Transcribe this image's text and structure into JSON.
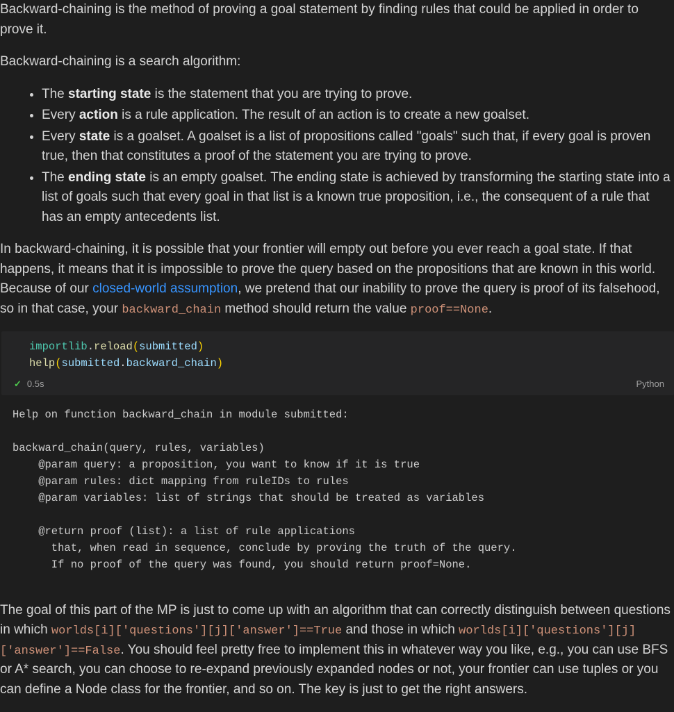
{
  "intro": {
    "para1": "Backward-chaining is the method of proving a goal statement by finding rules that could be applied in order to prove it.",
    "para2": "Backward-chaining is a search algorithm:",
    "bullets": [
      {
        "lead": "The ",
        "strong": "starting state",
        "rest": " is the statement that you are trying to prove."
      },
      {
        "lead": "Every ",
        "strong": "action",
        "rest": " is a rule application. The result of an action is to create a new goalset."
      },
      {
        "lead": "Every ",
        "strong": "state",
        "rest": " is a goalset. A goalset is a list of propositions called \"goals\" such that, if every goal is proven true, then that constitutes a proof of the statement you are trying to prove."
      },
      {
        "lead": "The ",
        "strong": "ending state",
        "rest": " is an empty goalset. The ending state is achieved by transforming the starting state into a list of goals such that every goal in that list is a known true proposition, i.e., the consequent of a rule that has an empty antecedents list."
      }
    ],
    "para3a": "In backward-chaining, it is possible that your frontier will empty out before you ever reach a goal state. If that happens, it means that it is impossible to prove the query based on the propositions that are known in this world. Because of our ",
    "link_text": "closed-world assumption",
    "para3b": ", we pretend that our inability to prove the query is proof of its falsehood, so in that case, your ",
    "code1": "backward_chain",
    "para3c": " method should return the value ",
    "code2": "proof==None",
    "para3d": "."
  },
  "cell": {
    "code_tokens": {
      "l1": {
        "a": "importlib",
        "b": ".",
        "c": "reload",
        "d": "(",
        "e": "submitted",
        "f": ")"
      },
      "l2": {
        "a": "help",
        "b": "(",
        "c": "submitted",
        "d": ".",
        "e": "backward_chain",
        "f": ")"
      }
    },
    "status_time": "0.5s",
    "kernel": "Python"
  },
  "output_text": "Help on function backward_chain in module submitted:\n\nbackward_chain(query, rules, variables)\n    @param query: a proposition, you want to know if it is true\n    @param rules: dict mapping from ruleIDs to rules\n    @param variables: list of strings that should be treated as variables\n    \n    @return proof (list): a list of rule applications\n      that, when read in sequence, conclude by proving the truth of the query.\n      If no proof of the query was found, you should return proof=None.",
  "tail": {
    "a": "The goal of this part of the MP is just to come up with an algorithm that can correctly distinguish between questions in which ",
    "code1": "worlds[i]['questions'][j]['answer']==True",
    "b": " and those in which ",
    "code2": "worlds[i]['questions'][j]['answer']==False",
    "c": ". You should feel pretty free to implement this in whatever way you like, e.g., you can use BFS or A* search, you can choose to re-expand previously expanded nodes or not, your frontier can use tuples or you can define a Node class for the frontier, and so on. The key is just to get the right answers."
  }
}
